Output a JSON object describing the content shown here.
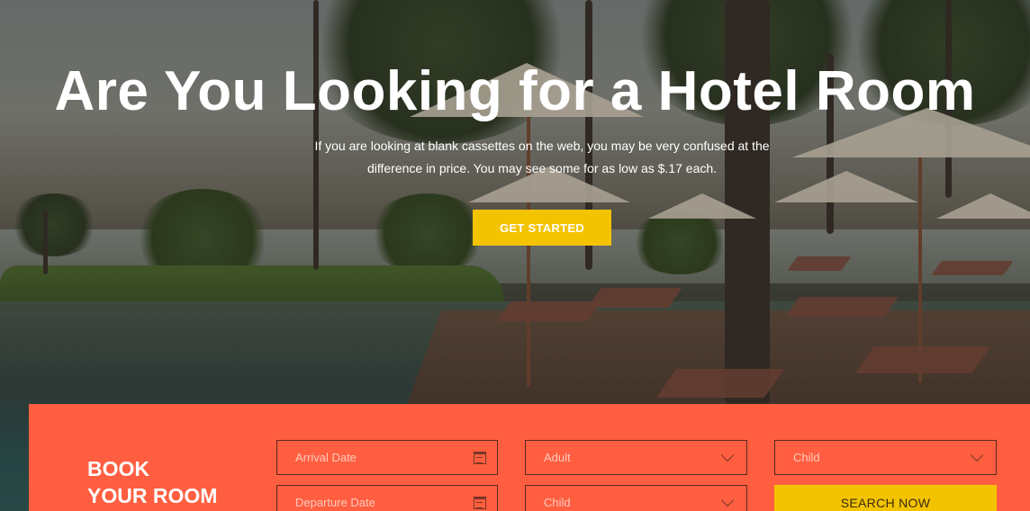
{
  "hero": {
    "title": "Are You Looking for a Hotel Room",
    "text_line1": "If you are looking at blank cassettes on the web, you may be very confused at the",
    "text_line2": "difference in price. You may see some for as low as $.17 each.",
    "cta_label": "GET STARTED"
  },
  "booking": {
    "title_line1": "BOOK",
    "title_line2": "YOUR ROOM",
    "arrival_placeholder": "Arrival Date",
    "departure_placeholder": "Departure Date",
    "adult_select": "Adult",
    "child_select_1": "Child",
    "child_select_2": "Child",
    "search_label": "SEARCH NOW"
  },
  "colors": {
    "accent_yellow": "#f3c300",
    "booking_bg": "#ff5e40"
  },
  "icons": {
    "arrival": "calendar-icon",
    "departure": "calendar-icon",
    "selects": "chevron-down-icon"
  }
}
